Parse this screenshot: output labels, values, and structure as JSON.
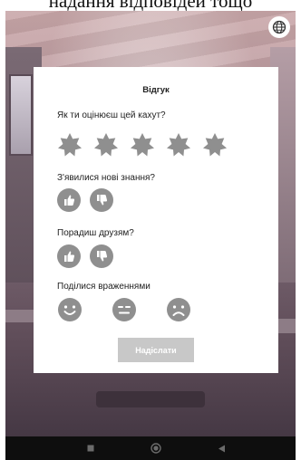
{
  "header_caption": "надання відповідей тощо",
  "feedback": {
    "title": "Відгук",
    "rating_question": "Як ти оцінюєш цей кахут?",
    "stars_total": 5,
    "learned_question": "З'явилися нові знання?",
    "recommend_question": "Порадиш друзям?",
    "mood_question": "Поділися враженнями",
    "submit_label": "Надіслати"
  },
  "icons": {
    "language": "globe-icon",
    "star": "star-icon",
    "thumbs_up": "thumbs-up-icon",
    "thumbs_down": "thumbs-down-icon",
    "faces": [
      "happy-face-icon",
      "neutral-face-icon",
      "sad-face-icon"
    ],
    "nav": [
      "recent-apps-icon",
      "home-icon",
      "back-icon"
    ]
  },
  "colors": {
    "icon_gray": "#8f8f8f",
    "submit_disabled": "#c8c8c8",
    "card": "#ffffff",
    "navbar": "#0e0e0e"
  }
}
